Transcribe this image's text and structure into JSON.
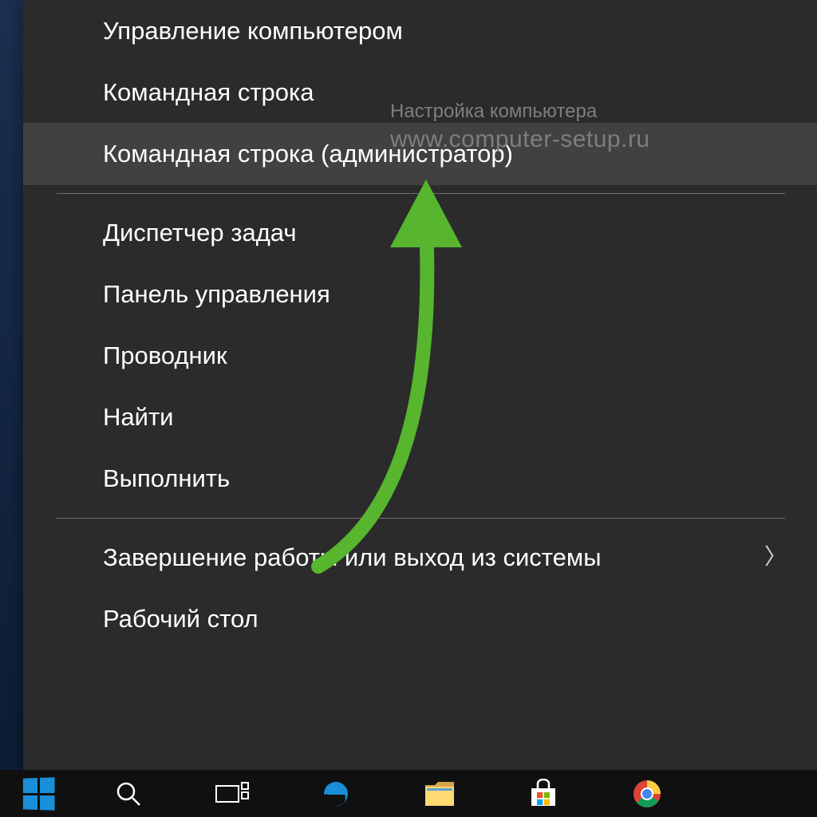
{
  "menu": {
    "sections": [
      [
        {
          "id": "computer-management",
          "label": "Управление компьютером",
          "highlighted": false,
          "submenu": false
        },
        {
          "id": "command-prompt",
          "label": "Командная строка",
          "highlighted": false,
          "submenu": false
        },
        {
          "id": "command-prompt-admin",
          "label": "Командная строка (администратор)",
          "highlighted": true,
          "submenu": false
        }
      ],
      [
        {
          "id": "task-manager",
          "label": "Диспетчер задач",
          "highlighted": false,
          "submenu": false
        },
        {
          "id": "control-panel",
          "label": "Панель управления",
          "highlighted": false,
          "submenu": false
        },
        {
          "id": "file-explorer",
          "label": "Проводник",
          "highlighted": false,
          "submenu": false
        },
        {
          "id": "search",
          "label": "Найти",
          "highlighted": false,
          "submenu": false
        },
        {
          "id": "run",
          "label": "Выполнить",
          "highlighted": false,
          "submenu": false
        }
      ],
      [
        {
          "id": "shutdown-signout",
          "label": "Завершение работы или выход из системы",
          "highlighted": false,
          "submenu": true
        },
        {
          "id": "desktop",
          "label": "Рабочий стол",
          "highlighted": false,
          "submenu": false
        }
      ]
    ]
  },
  "watermark": {
    "line1": "Настройка компьютера",
    "line2": "www.computer-setup.ru"
  },
  "annotation": {
    "arrow_color": "#57b52e"
  },
  "taskbar": {
    "icons": [
      "start",
      "search",
      "task-view",
      "edge",
      "explorer",
      "store",
      "chrome"
    ]
  }
}
